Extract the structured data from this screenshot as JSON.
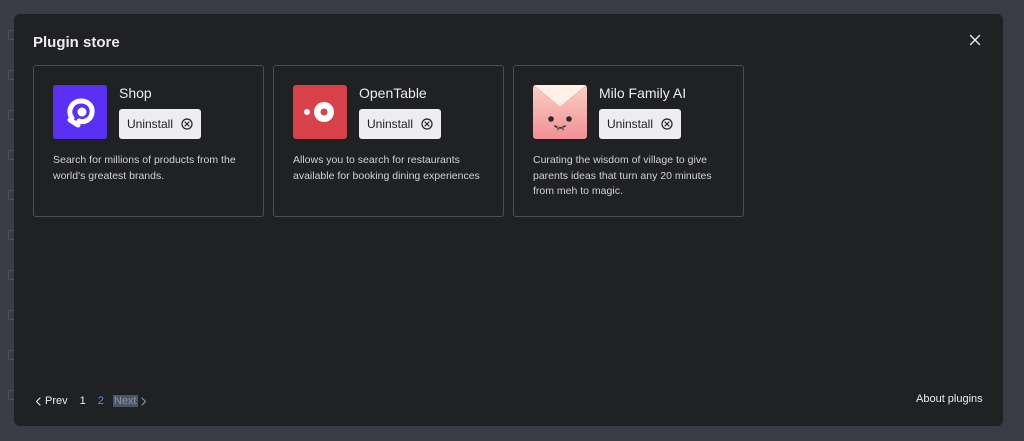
{
  "modal": {
    "title": "Plugin store"
  },
  "plugins": [
    {
      "name": "Shop",
      "button_label": "Uninstall",
      "description": "Search for millions of products from the world's greatest brands.",
      "logo_icon": "shop-logo-icon",
      "logo_color": "#5a31f4"
    },
    {
      "name": "OpenTable",
      "button_label": "Uninstall",
      "description": "Allows you to search for restaurants available for booking dining experiences",
      "logo_icon": "opentable-logo-icon",
      "logo_color": "#d9424b"
    },
    {
      "name": "Milo Family AI",
      "button_label": "Uninstall",
      "description": "Curating the wisdom of village to give parents ideas that turn any 20 minutes from meh to magic.",
      "logo_icon": "milo-logo-icon",
      "logo_color": "#f5a3a0"
    }
  ],
  "pagination": {
    "prev_label": "Prev",
    "pages": [
      "1",
      "2"
    ],
    "current_page": "2",
    "next_label": "Next"
  },
  "footer": {
    "about_label": "About plugins"
  },
  "colors": {
    "modal_bg": "#202123",
    "accent": "#5b8cf6"
  }
}
